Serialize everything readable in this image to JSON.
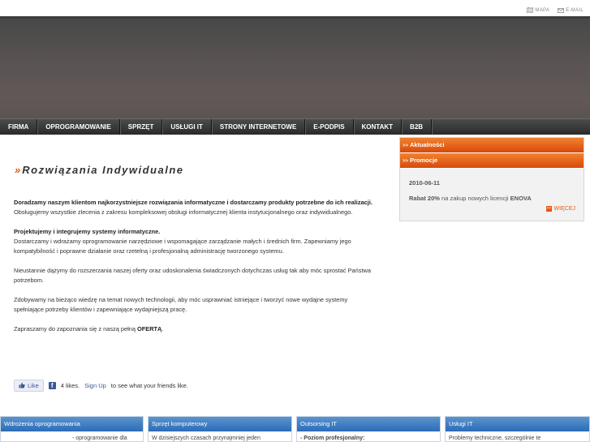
{
  "toplinks": {
    "map": "MAPA",
    "email": "E-MAIL"
  },
  "nav": [
    "FIRMA",
    "OPROGRAMOWANIE",
    "SPRZĘT",
    "USŁUGI IT",
    "STRONY INTERNETOWE",
    "E-PODPIS",
    "KONTAKT",
    "B2B"
  ],
  "page": {
    "title_arrow": "»",
    "title": "Rozwiązania Indywidualne"
  },
  "content": {
    "p1_bold": "Doradzamy naszym klientom najkorzystniejsze rozwiązania informatyczne i dostarczamy produkty potrzebne do ich realizacji.",
    "p1_text": "Obsługujemy wszystkie zlecenia z zakresu kompleksowej obsługi informatycznej klienta instytucjonalnego oraz indywidualnego.",
    "p2_bold": "Projektujemy i integrujemy systemy informatyczne.",
    "p2_text": "Dostarczamy i wdrażamy oprogramowanie narzędziowe i wspomagające zarządzanie małych i średnich firm. Zapewniamy jego kompatybilność i poprawne działanie oraz rzetelną i profesjonalną administrację tworzonego systemu.",
    "p3": "Nieustannie dążymy do rozszerzania naszej oferty oraz udoskonalenia świadczonych dotychczas usług tak aby móc sprostać Państwa potrzebom.",
    "p4": "Zdobywamy na bieżąco wiedzę na temat nowych technologii, aby móc usprawniać istniejące i tworzyć nowe wydajne systemy spełniające potrzeby klientów i zapewniające wydajniejszą pracę.",
    "p5_text": "Zapraszamy do zapoznania się z naszą pełną ",
    "p5_bold": "OFERTĄ",
    "p5_end": "."
  },
  "like": {
    "button": "Like",
    "count": "4 likes.",
    "signup": "Sign Up",
    "rest": " to see what your friends like."
  },
  "sidebar": {
    "bar1": "Aktualności",
    "bar2": "Promocje",
    "bar_arrow": ">>",
    "date": "2010-06-11",
    "news_bold": "Rabat 20%",
    "news_text": " na zakup nowych licencji ",
    "news_end": "ENOVA",
    "more": "WIĘCEJ",
    "more_arrow": ">>"
  },
  "tiles": [
    {
      "title": "Wdrożenia oprogramowania",
      "text": "- oprogramowanie dla"
    },
    {
      "title": "Sprzęt komputerowy",
      "text": "W dzisiejszych czasach przynajmniej jeden"
    },
    {
      "title": "Outsorsing IT",
      "text": "- Poziom profesjonalny:"
    },
    {
      "title": "Usługi IT",
      "text": "Problemy techniczne, szczególnie te"
    }
  ],
  "colors": {
    "accent": "#e8540d",
    "nav_bg": "#333333",
    "tile_header": "#3a78bf",
    "fb": "#3b5998"
  }
}
